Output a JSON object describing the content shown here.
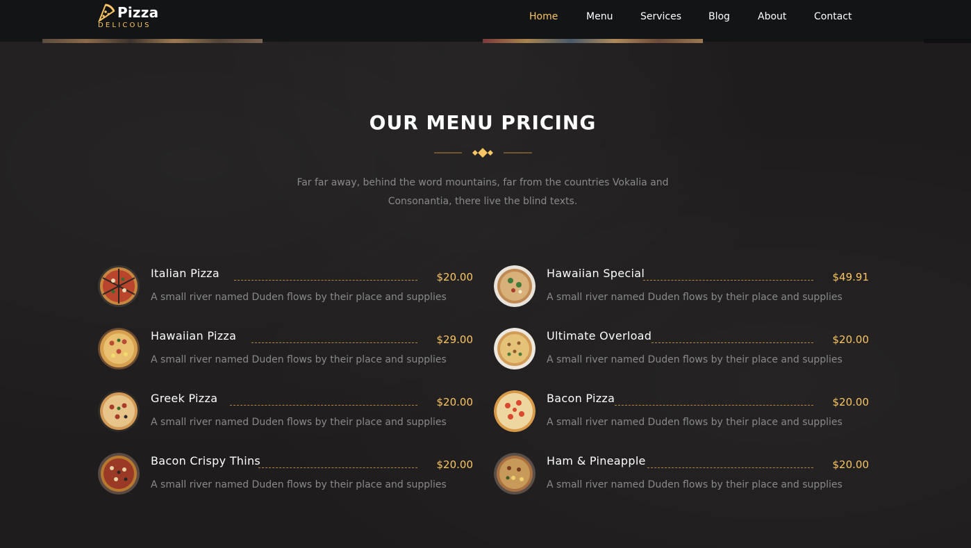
{
  "brand": {
    "name": "Pizza",
    "tagline": "DELICOUS",
    "icon": "pizza-slice-icon"
  },
  "nav": {
    "items": [
      {
        "label": "Home",
        "active": true
      },
      {
        "label": "Menu",
        "active": false
      },
      {
        "label": "Services",
        "active": false
      },
      {
        "label": "Blog",
        "active": false
      },
      {
        "label": "About",
        "active": false
      },
      {
        "label": "Contact",
        "active": false
      }
    ]
  },
  "section": {
    "title": "OUR MENU PRICING",
    "intro_line1": "Far far away, behind the word mountains, far from the countries Vokalia and",
    "intro_line2": "Consonantia, there live the blind texts."
  },
  "colors": {
    "accent": "#fac564",
    "background": "#1e1c1c",
    "navbar": "#121416",
    "muted_text": "#8a8a8a"
  },
  "menu_left": [
    {
      "name": "Italian Pizza",
      "price": "$20.00",
      "description": "A small river named Duden flows by their place and supplies"
    },
    {
      "name": "Hawaiian Pizza",
      "price": "$29.00",
      "description": "A small river named Duden flows by their place and supplies"
    },
    {
      "name": "Greek Pizza",
      "price": "$20.00",
      "description": "A small river named Duden flows by their place and supplies"
    },
    {
      "name": "Bacon Crispy Thins",
      "price": "$20.00",
      "description": "A small river named Duden flows by their place and supplies"
    }
  ],
  "menu_right": [
    {
      "name": "Hawaiian Special",
      "price": "$49.91",
      "description": "A small river named Duden flows by their place and supplies"
    },
    {
      "name": "Ultimate Overload",
      "price": "$20.00",
      "description": "A small river named Duden flows by their place and supplies"
    },
    {
      "name": "Bacon Pizza",
      "price": "$20.00",
      "description": "A small river named Duden flows by their place and supplies"
    },
    {
      "name": "Ham & Pineapple",
      "price": "$20.00",
      "description": "A small river named Duden flows by their place and supplies"
    }
  ]
}
